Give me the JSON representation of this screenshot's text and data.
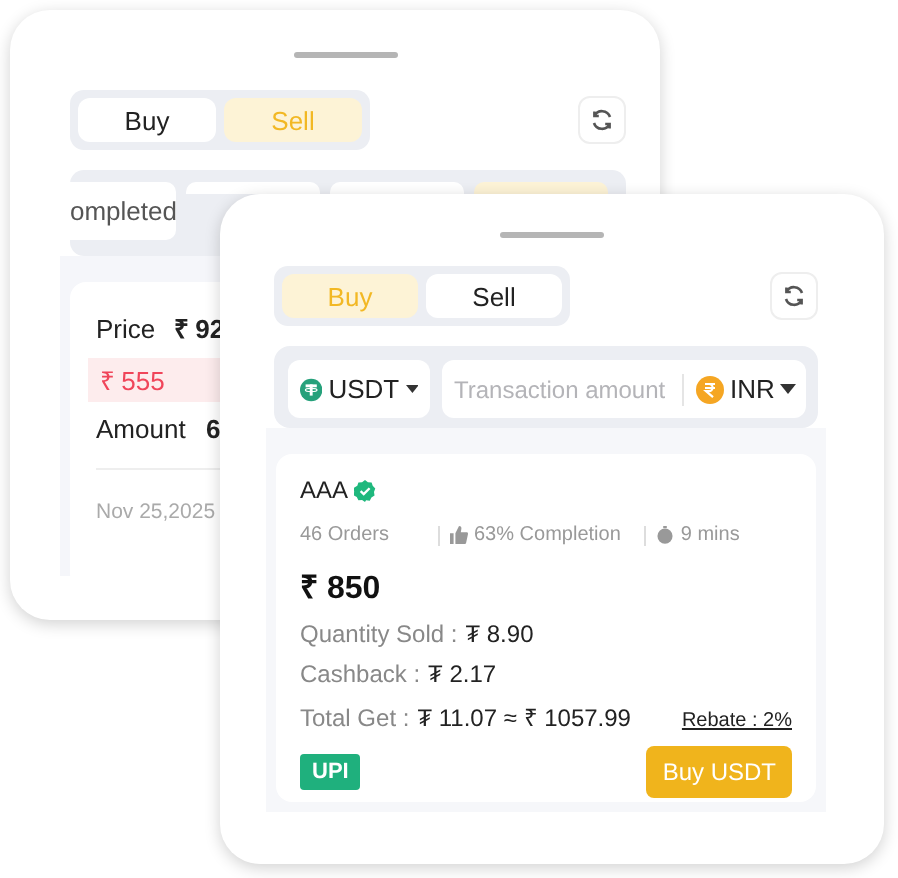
{
  "back_panel": {
    "trade_tabs": [
      {
        "label": "Buy",
        "selected": false
      },
      {
        "label": "Sell",
        "selected": true
      }
    ],
    "status_tabs": [
      {
        "label": "ompleted",
        "selected": false
      },
      {
        "selected": false
      },
      {
        "selected": false
      },
      {
        "selected": true
      }
    ],
    "order": {
      "price_label": "Price",
      "price": "₹ 92",
      "badge": "₹ 555",
      "amount_label": "Amount",
      "amount": "6",
      "date": "Nov 25,2025"
    }
  },
  "front_panel": {
    "trade_tabs": [
      {
        "label": "Buy",
        "selected": true
      },
      {
        "label": "Sell",
        "selected": false
      }
    ],
    "filter": {
      "coin": "USDT",
      "placeholder": "Transaction amount",
      "currency": "INR"
    },
    "ad": {
      "merchant": "AAA",
      "verified": true,
      "orders": "46 Orders",
      "completion": "63% Completion",
      "time": "9 mins",
      "price": "₹ 850",
      "rows": [
        {
          "label": "Quantity Sold :",
          "value": "₮ 8.90"
        },
        {
          "label": "Cashback :",
          "value": "₮ 2.17"
        },
        {
          "label": "Total Get :",
          "value": "₮ 11.07 ≈ ₹ 1057.99"
        }
      ],
      "rebate": "Rebate : 2%",
      "payment": "UPI",
      "action": "Buy USDT"
    }
  }
}
